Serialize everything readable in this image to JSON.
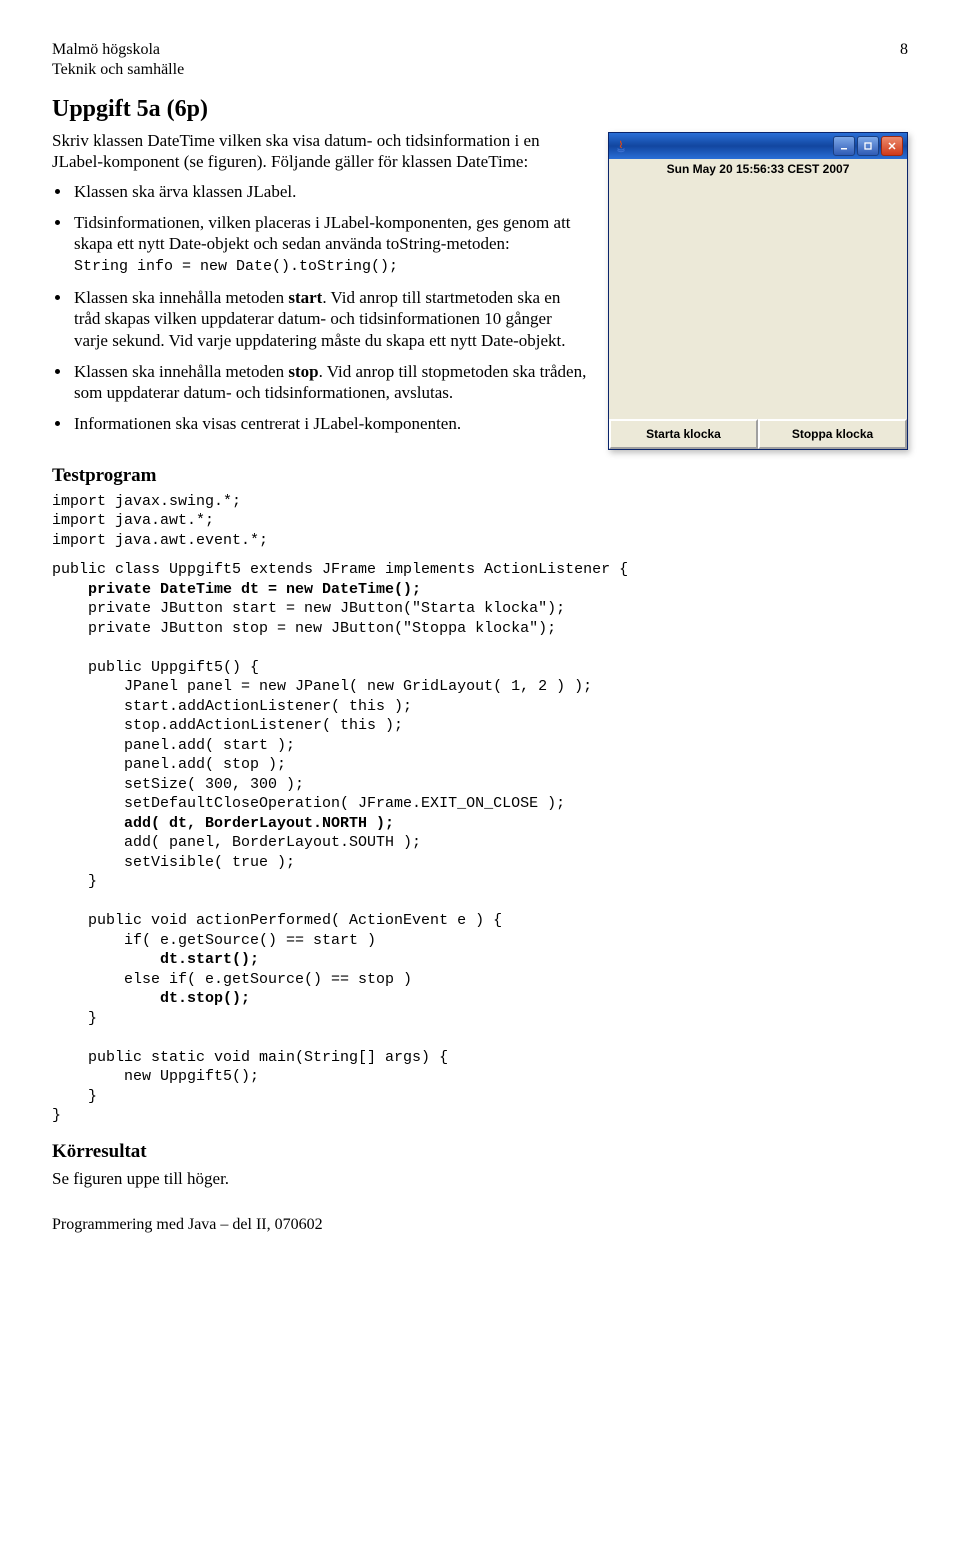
{
  "header": {
    "institution": "Malmö högskola",
    "department": "Teknik och samhälle",
    "page_no": "8"
  },
  "title": "Uppgift 5a (6p)",
  "intro_p1": "Skriv klassen DateTime vilken ska visa datum- och tidsinformation i en JLabel-komponent (se figuren). Följande gäller för klassen DateTime:",
  "bullets": {
    "b1": "Klassen ska ärva klassen JLabel.",
    "b2a": "Tidsinformationen, vilken placeras i JLabel-komponenten, ges genom att skapa ett nytt Date-objekt och sedan använda toString-metoden:",
    "b2code": "String info = new Date().toString();",
    "b3a": "Klassen ska innehålla metoden ",
    "b3b": "start",
    "b3c": ". Vid anrop till startmetoden ska en tråd skapas vilken uppdaterar datum- och tidsinformationen 10 gånger varje sekund. Vid varje uppdatering måste du skapa ett nytt Date-objekt.",
    "b4a": "Klassen ska innehålla metoden ",
    "b4b": "stop",
    "b4c": ". Vid anrop till stopmetoden ska tråden, som uppdaterar datum- och tidsinformationen, avslutas.",
    "b5": "Informationen ska visas centrerat i JLabel-komponenten."
  },
  "testprogram_heading": "Testprogram",
  "code_imports": "import javax.swing.*;\nimport java.awt.*;\nimport java.awt.event.*;",
  "code_class": "public class Uppgift5 extends JFrame implements ActionListener {\n    private DateTime dt = new DateTime();\n    private JButton start = new JButton(\"Starta klocka\");\n    private JButton stop = new JButton(\"Stoppa klocka\");\n\n    public Uppgift5() {\n        JPanel panel = new JPanel( new GridLayout( 1, 2 ) );\n        start.addActionListener( this );\n        stop.addActionListener( this );\n        panel.add( start );\n        panel.add( stop );\n        setSize( 300, 300 );\n        setDefaultCloseOperation( JFrame.EXIT_ON_CLOSE );\n        add( dt, BorderLayout.NORTH );\n        add( panel, BorderLayout.SOUTH );\n        setVisible( true );\n    }\n\n    public void actionPerformed( ActionEvent e ) {\n        if( e.getSource() == start )\n            dt.start();\n        else if( e.getSource() == stop )\n            dt.stop();\n    }\n\n    public static void main(String[] args) {\n        new Uppgift5();\n    }\n}",
  "korresultat_heading": "Körresultat",
  "korresultat_text": "Se figuren uppe till höger.",
  "footer_text": "Programmering med Java – del II, 070602",
  "window": {
    "title": "",
    "date_text": "Sun May 20 15:56:33 CEST 2007",
    "btn_start": "Starta klocka",
    "btn_stop": "Stoppa klocka"
  }
}
